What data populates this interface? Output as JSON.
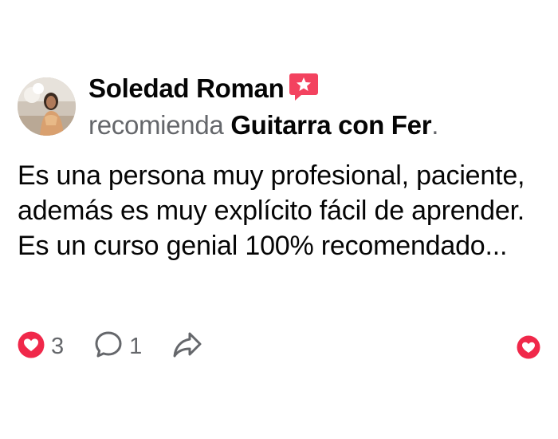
{
  "post": {
    "author": "Soledad Roman",
    "verb": "recomienda",
    "page_name": "Guitarra con Fer",
    "period": ".",
    "text": "Es una persona muy profesional, paciente, además es muy explícito fácil de aprender. Es un curso genial 100% recomendado..."
  },
  "actions": {
    "reactions_count": "3",
    "comments_count": "1"
  },
  "icons": {
    "recommend_badge": "recommendation-star-icon",
    "reaction": "heart-reaction-icon",
    "comment": "comment-bubble-icon",
    "share": "share-arrow-icon",
    "react_button": "heart-react-button-icon"
  },
  "colors": {
    "accent_red": "#f0284a",
    "badge_red": "#f3425f",
    "secondary_text": "#65676b",
    "primary_text": "#050505"
  }
}
